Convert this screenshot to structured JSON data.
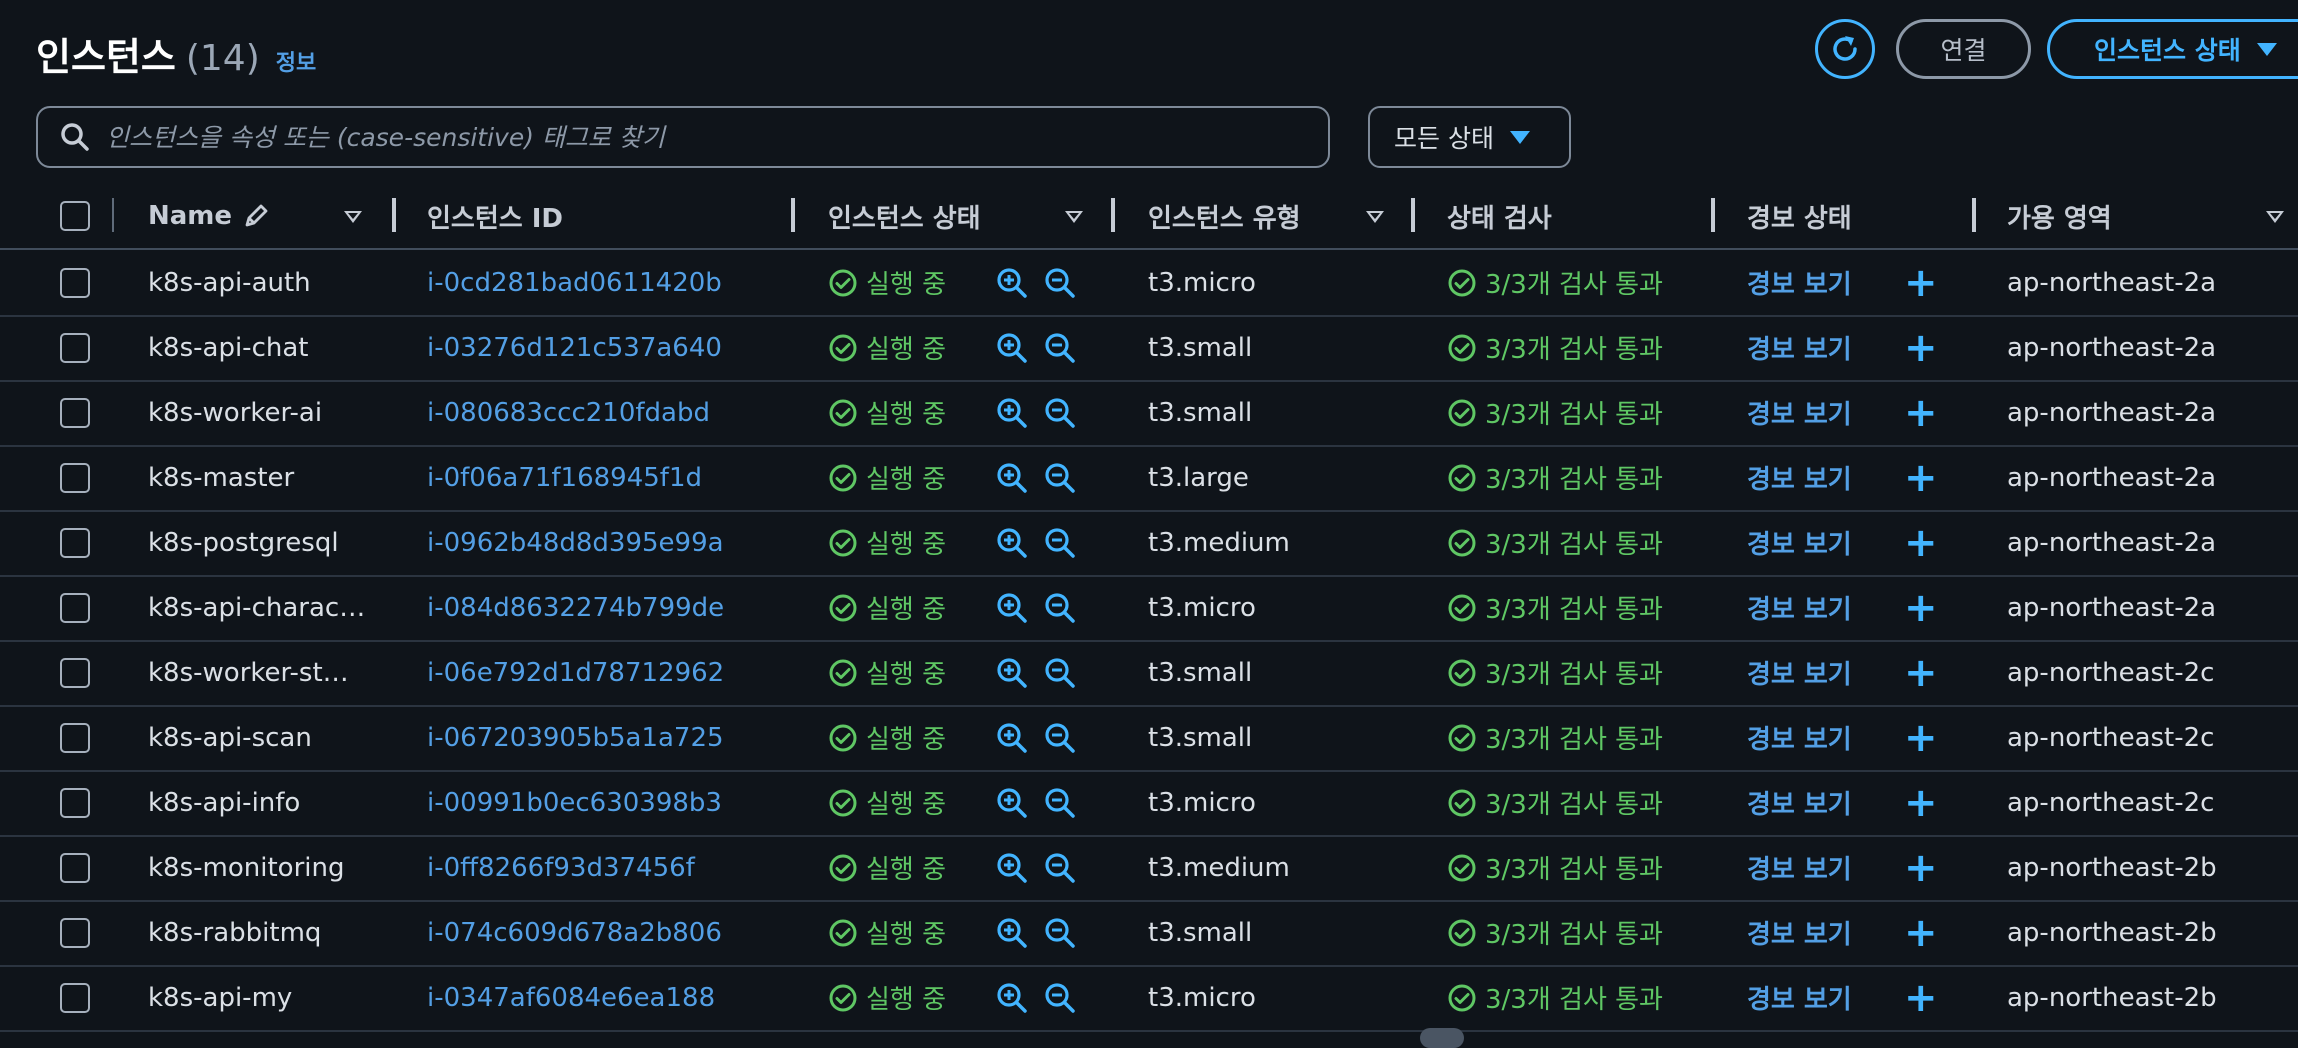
{
  "header": {
    "title": "인스턴스",
    "count": "(14)",
    "info": "정보"
  },
  "actions": {
    "connect": "연결",
    "instance_state": "인스턴스 상태"
  },
  "search": {
    "placeholder": "인스턴스을 속성 또는 (case-sensitive) 태그로 찾기"
  },
  "filter": {
    "label": "모든 상태"
  },
  "columns": {
    "name": "Name",
    "instance_id": "인스턴스 ID",
    "instance_state": "인스턴스 상태",
    "instance_type": "인스턴스 유형",
    "status_check": "상태 검사",
    "alarm_status": "경보 상태",
    "availability_zone": "가용 영역"
  },
  "rows": [
    {
      "name": "k8s-api-auth",
      "id": "i-0cd281bad0611420b",
      "state": "실행 중",
      "type": "t3.micro",
      "check": "3/3개 검사 통과",
      "alarm": "경보 보기",
      "az": "ap-northeast-2a"
    },
    {
      "name": "k8s-api-chat",
      "id": "i-03276d121c537a640",
      "state": "실행 중",
      "type": "t3.small",
      "check": "3/3개 검사 통과",
      "alarm": "경보 보기",
      "az": "ap-northeast-2a"
    },
    {
      "name": "k8s-worker-ai",
      "id": "i-080683ccc210fdabd",
      "state": "실행 중",
      "type": "t3.small",
      "check": "3/3개 검사 통과",
      "alarm": "경보 보기",
      "az": "ap-northeast-2a"
    },
    {
      "name": "k8s-master",
      "id": "i-0f06a71f168945f1d",
      "state": "실행 중",
      "type": "t3.large",
      "check": "3/3개 검사 통과",
      "alarm": "경보 보기",
      "az": "ap-northeast-2a"
    },
    {
      "name": "k8s-postgresql",
      "id": "i-0962b48d8d395e99a",
      "state": "실행 중",
      "type": "t3.medium",
      "check": "3/3개 검사 통과",
      "alarm": "경보 보기",
      "az": "ap-northeast-2a"
    },
    {
      "name": "k8s-api-charac…",
      "id": "i-084d8632274b799de",
      "state": "실행 중",
      "type": "t3.micro",
      "check": "3/3개 검사 통과",
      "alarm": "경보 보기",
      "az": "ap-northeast-2a"
    },
    {
      "name": "k8s-worker-st…",
      "id": "i-06e792d1d78712962",
      "state": "실행 중",
      "type": "t3.small",
      "check": "3/3개 검사 통과",
      "alarm": "경보 보기",
      "az": "ap-northeast-2c"
    },
    {
      "name": "k8s-api-scan",
      "id": "i-067203905b5a1a725",
      "state": "실행 중",
      "type": "t3.small",
      "check": "3/3개 검사 통과",
      "alarm": "경보 보기",
      "az": "ap-northeast-2c"
    },
    {
      "name": "k8s-api-info",
      "id": "i-00991b0ec630398b3",
      "state": "실행 중",
      "type": "t3.micro",
      "check": "3/3개 검사 통과",
      "alarm": "경보 보기",
      "az": "ap-northeast-2c"
    },
    {
      "name": "k8s-monitoring",
      "id": "i-0ff8266f93d37456f",
      "state": "실행 중",
      "type": "t3.medium",
      "check": "3/3개 검사 통과",
      "alarm": "경보 보기",
      "az": "ap-northeast-2b"
    },
    {
      "name": "k8s-rabbitmq",
      "id": "i-074c609d678a2b806",
      "state": "실행 중",
      "type": "t3.small",
      "check": "3/3개 검사 통과",
      "alarm": "경보 보기",
      "az": "ap-northeast-2b"
    },
    {
      "name": "k8s-api-my",
      "id": "i-0347af6084e6ea188",
      "state": "실행 중",
      "type": "t3.micro",
      "check": "3/3개 검사 통과",
      "alarm": "경보 보기",
      "az": "ap-northeast-2b"
    }
  ],
  "colors": {
    "background": "#0f141a",
    "link": "#539fe5",
    "accent": "#42b4ff",
    "success": "#5fc764"
  },
  "icons": {
    "refresh": "refresh-icon",
    "search": "search-icon",
    "edit": "pencil-icon",
    "running": "check-circle-icon",
    "zoom_in": "zoom-in-icon",
    "zoom_out": "zoom-out-icon",
    "add": "plus-icon"
  }
}
